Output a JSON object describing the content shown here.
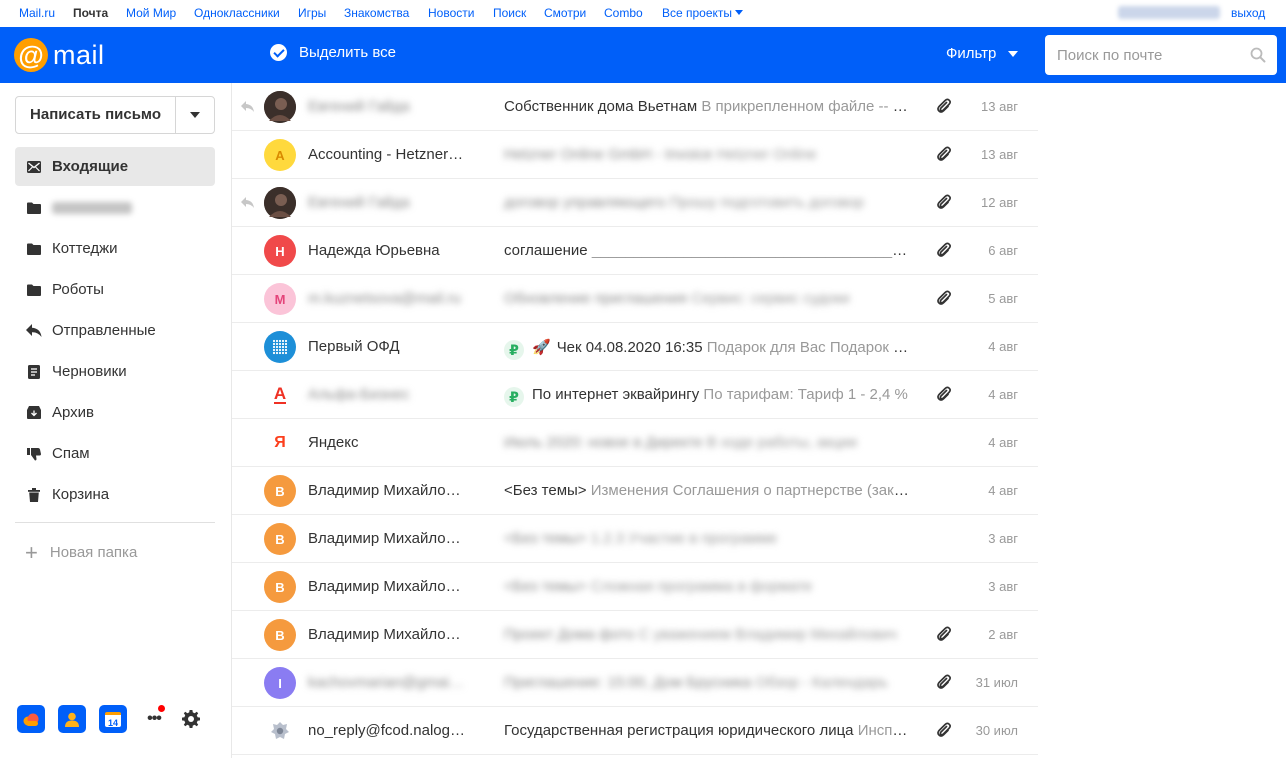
{
  "portal": {
    "links": [
      "Mail.ru",
      "Почта",
      "Мой Мир",
      "Одноклассники",
      "Игры",
      "Знакомства",
      "Новости",
      "Поиск",
      "Смотри",
      "Combo",
      "Все проекты"
    ],
    "logout": "выход"
  },
  "header": {
    "logo_at": "@",
    "logo_text": "mail",
    "select_all": "Выделить все",
    "filter": "Фильтр",
    "search_placeholder": "Поиск по почте"
  },
  "sidebar": {
    "compose": "Написать письмо",
    "folders": [
      {
        "label": "Входящие",
        "icon": "envelope-icon",
        "active": true
      },
      {
        "label": "",
        "icon": "folder-icon",
        "blurred": true
      },
      {
        "label": "Коттеджи",
        "icon": "folder-icon"
      },
      {
        "label": "Роботы",
        "icon": "folder-icon"
      },
      {
        "label": "Отправленные",
        "icon": "sent-icon"
      },
      {
        "label": "Черновики",
        "icon": "draft-icon"
      },
      {
        "label": "Архив",
        "icon": "archive-icon"
      },
      {
        "label": "Спам",
        "icon": "spam-icon"
      },
      {
        "label": "Корзина",
        "icon": "trash-icon"
      }
    ],
    "new_folder": "Новая папка",
    "apps": [
      "cloud-app-icon",
      "contacts-app-icon",
      "calendar-app-icon"
    ],
    "calendar_day": "14"
  },
  "messages": [
    {
      "avatar_letter": "",
      "avatar_color": "#5a4a44",
      "sender": "Евгений Гайда",
      "sender_blurred": true,
      "replied": true,
      "subject": "Собственник дома Вьетнам",
      "snippet": "В прикрепленном файле -- таблица",
      "attachment": true,
      "date": "13 авг"
    },
    {
      "avatar_letter": "A",
      "avatar_color": "#ffd93d",
      "avatar_text_color": "#d98a00",
      "sender": "Accounting - Hetzner Online",
      "subject": "Hetzner Online GmbH - Invoice",
      "snippet": "Hetzner Online",
      "subject_blurred": true,
      "attachment": true,
      "date": "13 авг"
    },
    {
      "avatar_letter": "",
      "avatar_color": "#5a4a44",
      "sender": "Евгений Гайда",
      "sender_blurred": true,
      "replied": true,
      "subject": "договор управляющего",
      "snippet": "Прошу подготовить договор",
      "subject_blurred": true,
      "attachment": true,
      "date": "12 авг"
    },
    {
      "avatar_letter": "Н",
      "avatar_color": "#f0494a",
      "sender": "Надежда Юрьевна",
      "subject": "соглашение",
      "snippet": "________________________________________________",
      "attachment": true,
      "date": "6 авг"
    },
    {
      "avatar_letter": "М",
      "avatar_color": "#fbc4d8",
      "avatar_text_color": "#e4447a",
      "sender": "m.kuznetsova@mail.ru",
      "sender_blurred": true,
      "subject": "Обновление приглашения",
      "snippet": "Сервис: сервис судоки",
      "subject_blurred": true,
      "attachment": true,
      "date": "5 авг"
    },
    {
      "avatar_letter": "",
      "avatar_color": "#1d8fd8",
      "avatar_kind": "ofd",
      "sender": "Первый ОФД",
      "ruble": true,
      "rocket": "🚀",
      "subject": "Чек 04.08.2020 16:35",
      "snippet": "Подарок для Вас Подарок для Вас",
      "attachment": false,
      "date": "4 авг"
    },
    {
      "avatar_letter": "А",
      "avatar_color": "#ffffff",
      "avatar_text_color": "#ef3124",
      "avatar_kind": "alfa",
      "sender": "Альфа-Бизнес",
      "sender_blurred": true,
      "ruble": true,
      "subject": "По интернет эквайрингу",
      "snippet": "По тарифам: Тариф 1 - 2,4 %",
      "attachment": true,
      "date": "4 авг"
    },
    {
      "avatar_letter": "Я",
      "avatar_color": "#ffffff",
      "avatar_text_color": "#fc3f1d",
      "avatar_kind": "yandex",
      "sender": "Яндекс",
      "subject": "Июль 2020: новое в Директе",
      "snippet": "В ходе работы, акции",
      "subject_blurred": true,
      "attachment": false,
      "date": "4 авг"
    },
    {
      "avatar_letter": "В",
      "avatar_color": "#f59a3e",
      "sender": "Владимир Михайлович",
      "subject": "<Без темы>",
      "snippet": "Изменения Соглашения о партнерстве (заключено)",
      "attachment": false,
      "date": "4 авг"
    },
    {
      "avatar_letter": "В",
      "avatar_color": "#f59a3e",
      "sender": "Владимир Михайлович",
      "subject": "<Без темы>",
      "snippet": "1.2.3 Участие в программе",
      "subject_blurred": true,
      "attachment": false,
      "date": "3 авг"
    },
    {
      "avatar_letter": "В",
      "avatar_color": "#f59a3e",
      "sender": "Владимир Михайлович",
      "subject": "<Без темы>",
      "snippet": "Сложная программа в формате",
      "subject_blurred": true,
      "attachment": false,
      "date": "3 авг"
    },
    {
      "avatar_letter": "В",
      "avatar_color": "#f59a3e",
      "sender": "Владимир Михайлович",
      "subject": "Проект Дома фото",
      "snippet": "С уважением Владимир Михайлович",
      "subject_blurred": true,
      "attachment": true,
      "date": "2 авг"
    },
    {
      "avatar_letter": "I",
      "avatar_color": "#8a7cf2",
      "sender": "kachovmarian@gmail.com",
      "sender_blurred": true,
      "subject": "Приглашение: 15:00, Дом Брусника",
      "snippet": "Обзор - Календарь",
      "subject_blurred": true,
      "attachment": true,
      "date": "31 июл"
    },
    {
      "avatar_letter": "",
      "avatar_color": "#ffffff",
      "avatar_kind": "emblem",
      "sender": "no_reply@fcod.nalog.ru",
      "subject": "Государственная регистрация юридического лица",
      "snippet": "Инспекция",
      "attachment": true,
      "date": "30 июл"
    }
  ],
  "colors": {
    "brand_blue": "#005ff9",
    "logo_orange": "#ff9e00"
  }
}
